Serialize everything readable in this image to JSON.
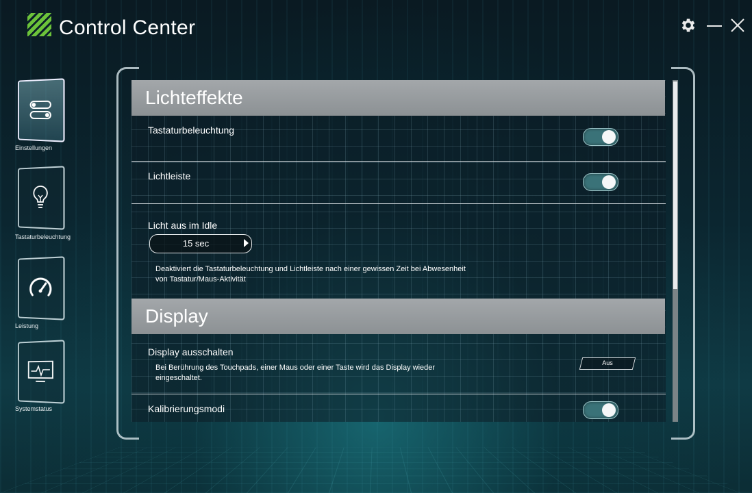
{
  "app": {
    "title": "Control Center"
  },
  "window": {
    "settings_icon": "gear-icon",
    "minimize_icon": "minimize-icon",
    "close_icon": "close-icon"
  },
  "sidebar": {
    "items": [
      {
        "label": "Einstellungen",
        "icon": "toggles-icon",
        "active": true
      },
      {
        "label": "Tastaturbeleuchtung",
        "icon": "lightbulb-icon",
        "active": false
      },
      {
        "label": "Leistung",
        "icon": "speedometer-icon",
        "active": false
      },
      {
        "label": "Systemstatus",
        "icon": "monitor-pulse-icon",
        "active": false
      }
    ]
  },
  "sections": {
    "lighting": {
      "title": "Lichteffekte",
      "keyboard_backlight": {
        "label": "Tastaturbeleuchtung",
        "enabled": true
      },
      "light_bar": {
        "label": "Lichtleiste",
        "enabled": true
      },
      "idle": {
        "label": "Licht aus im Idle",
        "value": "15 sec",
        "description_line1": "Deaktiviert die Tastaturbeleuchtung und Lichtleiste nach einer gewissen Zeit bei Abwesenheit",
        "description_line2": "von Tastatur/Maus-Aktivität"
      }
    },
    "display": {
      "title": "Display",
      "display_off": {
        "label": "Display ausschalten",
        "description_line1": "Bei Berührung des Touchpads, einer Maus oder einer Taste wird das Display wieder",
        "description_line2": "eingeschaltet.",
        "button": "Aus"
      },
      "calibration": {
        "label": "Kalibrierungsmodi",
        "enabled": true
      }
    }
  },
  "colors": {
    "accent_green": "#6cc33a",
    "toggle_on": "#3a7278",
    "header_gray": "#9a9ea1"
  }
}
